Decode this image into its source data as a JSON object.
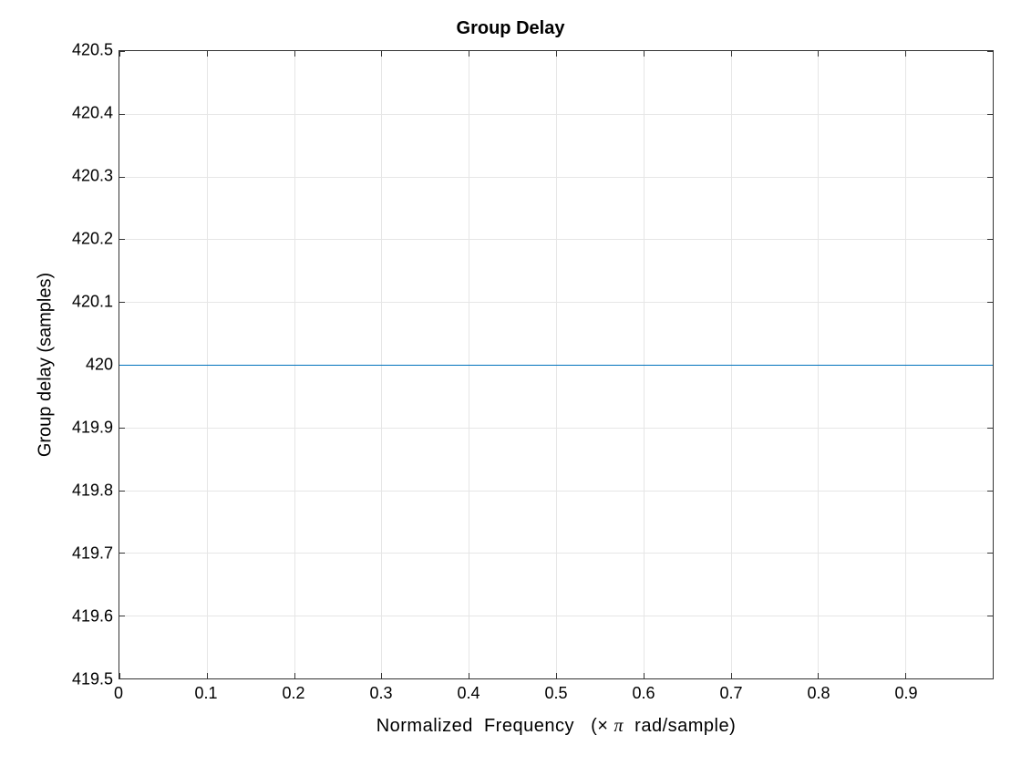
{
  "chart_data": {
    "type": "line",
    "title": "Group Delay",
    "xlabel_parts": [
      "Normalized  Frequency   (",
      "×",
      "π",
      "  rad/sample)"
    ],
    "ylabel": "Group delay (samples)",
    "xlim": [
      0,
      1
    ],
    "ylim": [
      419.5,
      420.5
    ],
    "x_ticks": [
      0,
      0.1,
      0.2,
      0.3,
      0.4,
      0.5,
      0.6,
      0.7,
      0.8,
      0.9
    ],
    "y_ticks": [
      419.5,
      419.6,
      419.7,
      419.8,
      419.9,
      420,
      420.1,
      420.2,
      420.3,
      420.4,
      420.5
    ],
    "series": [
      {
        "name": "group delay",
        "color": "#0072bd",
        "x": [
          0,
          1
        ],
        "y": [
          420,
          420
        ]
      }
    ]
  },
  "labels": {
    "title": "Group Delay",
    "ylabel": "Group delay (samples)",
    "x_ticks": [
      "0",
      "0.1",
      "0.2",
      "0.3",
      "0.4",
      "0.5",
      "0.6",
      "0.7",
      "0.8",
      "0.9"
    ],
    "y_ticks": [
      "419.5",
      "419.6",
      "419.7",
      "419.8",
      "419.9",
      "420",
      "420.1",
      "420.2",
      "420.3",
      "420.4",
      "420.5"
    ]
  }
}
